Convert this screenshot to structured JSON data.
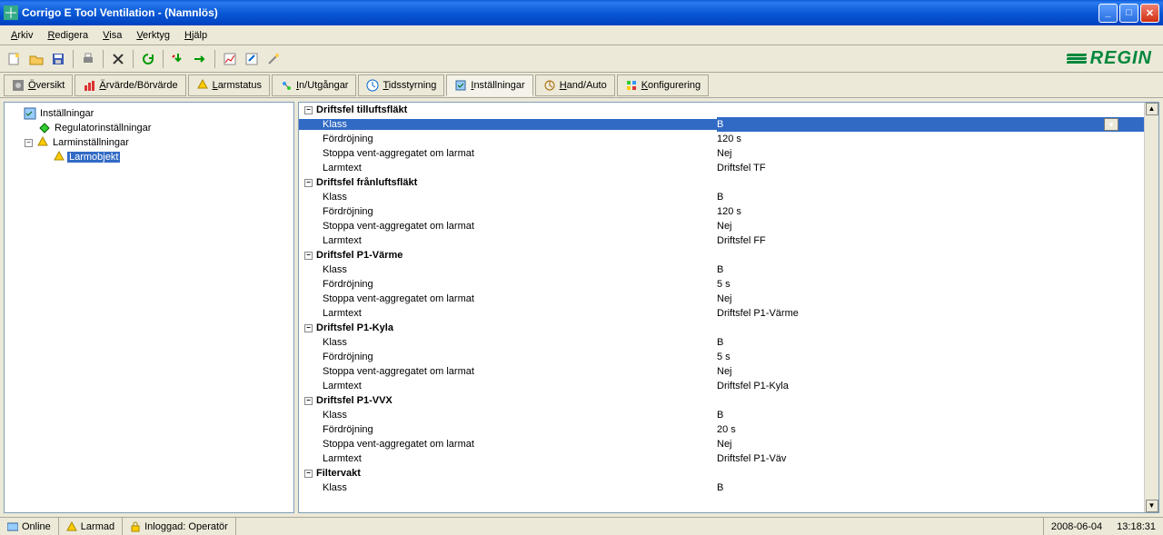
{
  "title": "Corrigo E Tool Ventilation - (Namnlös)",
  "brand": "REGIN",
  "menus": [
    "Arkiv",
    "Redigera",
    "Visa",
    "Verktyg",
    "Hjälp"
  ],
  "tabs": [
    {
      "label": "Översikt"
    },
    {
      "label": "Ärvärde/Börvärde"
    },
    {
      "label": "Larmstatus"
    },
    {
      "label": "In/Utgångar"
    },
    {
      "label": "Tidsstyrning"
    },
    {
      "label": "Inställningar",
      "active": true
    },
    {
      "label": "Hand/Auto"
    },
    {
      "label": "Konfigurering"
    }
  ],
  "tree": {
    "root": "Inställningar",
    "items": [
      {
        "label": "Regulatorinställningar"
      },
      {
        "label": "Larminställningar",
        "expanded": true,
        "children": [
          {
            "label": "Larmobjekt",
            "selected": true
          }
        ]
      }
    ]
  },
  "groups": [
    {
      "title": "Driftsfel tilluftsfläkt",
      "rows": [
        {
          "k": "Klass",
          "v": "B",
          "selected": true,
          "dropdown": true
        },
        {
          "k": "Fördröjning",
          "v": "120 s"
        },
        {
          "k": "Stoppa vent-aggregatet om larmat",
          "v": "Nej"
        },
        {
          "k": "Larmtext",
          "v": "Driftsfel TF"
        }
      ]
    },
    {
      "title": "Driftsfel frånluftsfläkt",
      "rows": [
        {
          "k": "Klass",
          "v": "B"
        },
        {
          "k": "Fördröjning",
          "v": "120 s"
        },
        {
          "k": "Stoppa vent-aggregatet om larmat",
          "v": "Nej"
        },
        {
          "k": "Larmtext",
          "v": "Driftsfel FF"
        }
      ]
    },
    {
      "title": "Driftsfel P1-Värme",
      "rows": [
        {
          "k": "Klass",
          "v": "B"
        },
        {
          "k": "Fördröjning",
          "v": "5 s"
        },
        {
          "k": "Stoppa vent-aggregatet om larmat",
          "v": "Nej"
        },
        {
          "k": "Larmtext",
          "v": "Driftsfel P1-Värme"
        }
      ]
    },
    {
      "title": "Driftsfel P1-Kyla",
      "rows": [
        {
          "k": "Klass",
          "v": "B"
        },
        {
          "k": "Fördröjning",
          "v": "5 s"
        },
        {
          "k": "Stoppa vent-aggregatet om larmat",
          "v": "Nej"
        },
        {
          "k": "Larmtext",
          "v": "Driftsfel P1-Kyla"
        }
      ]
    },
    {
      "title": "Driftsfel P1-VVX",
      "rows": [
        {
          "k": "Klass",
          "v": "B"
        },
        {
          "k": "Fördröjning",
          "v": "20 s"
        },
        {
          "k": "Stoppa vent-aggregatet om larmat",
          "v": "Nej"
        },
        {
          "k": "Larmtext",
          "v": "Driftsfel P1-Väv"
        }
      ]
    },
    {
      "title": "Filtervakt",
      "rows": [
        {
          "k": "Klass",
          "v": "B"
        }
      ]
    }
  ],
  "status": {
    "online": "Online",
    "larmad": "Larmad",
    "login": "Inloggad: Operatör",
    "date": "2008-06-04",
    "time": "13:18:31"
  }
}
